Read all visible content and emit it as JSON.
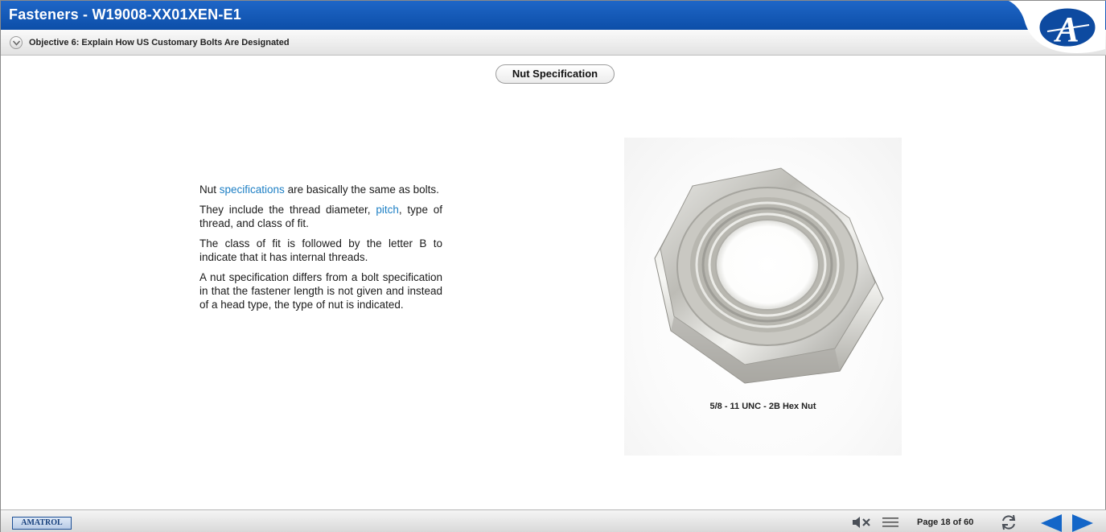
{
  "header": {
    "title": "Fasteners - W19008-XX01XEN-E1",
    "objective": "Objective 6: Explain How US Customary Bolts Are Designated"
  },
  "section": {
    "title": "Nut Specification"
  },
  "content": {
    "p1_before": "Nut ",
    "p1_link": "specifications",
    "p1_after": " are basically the same as bolts.",
    "p2_before": "They include the thread diameter, ",
    "p2_link": "pitch",
    "p2_after": ", type of thread, and class of fit.",
    "p3": "The class of fit is followed by the letter B to indicate that it has internal threads.",
    "p4": "A nut specification differs from a bolt specification in that the fastener length is not given and instead of a head type, the type of nut is indicated."
  },
  "figure": {
    "caption": "5/8 - 11 UNC - 2B Hex Nut"
  },
  "footer": {
    "logo_text": "AMATROL",
    "page_label": "Page 18 of 60"
  },
  "icons": {
    "logo": "amatrol-a-logo-icon",
    "collapse": "chevron-down-icon",
    "mute": "speaker-mute-icon",
    "menu": "menu-icon",
    "reload": "reload-icon",
    "prev": "arrow-left-icon",
    "next": "arrow-right-icon"
  },
  "colors": {
    "title_bar": "#0c4ea8",
    "link": "#1d7fc4",
    "nav_arrow": "#1466c8"
  }
}
